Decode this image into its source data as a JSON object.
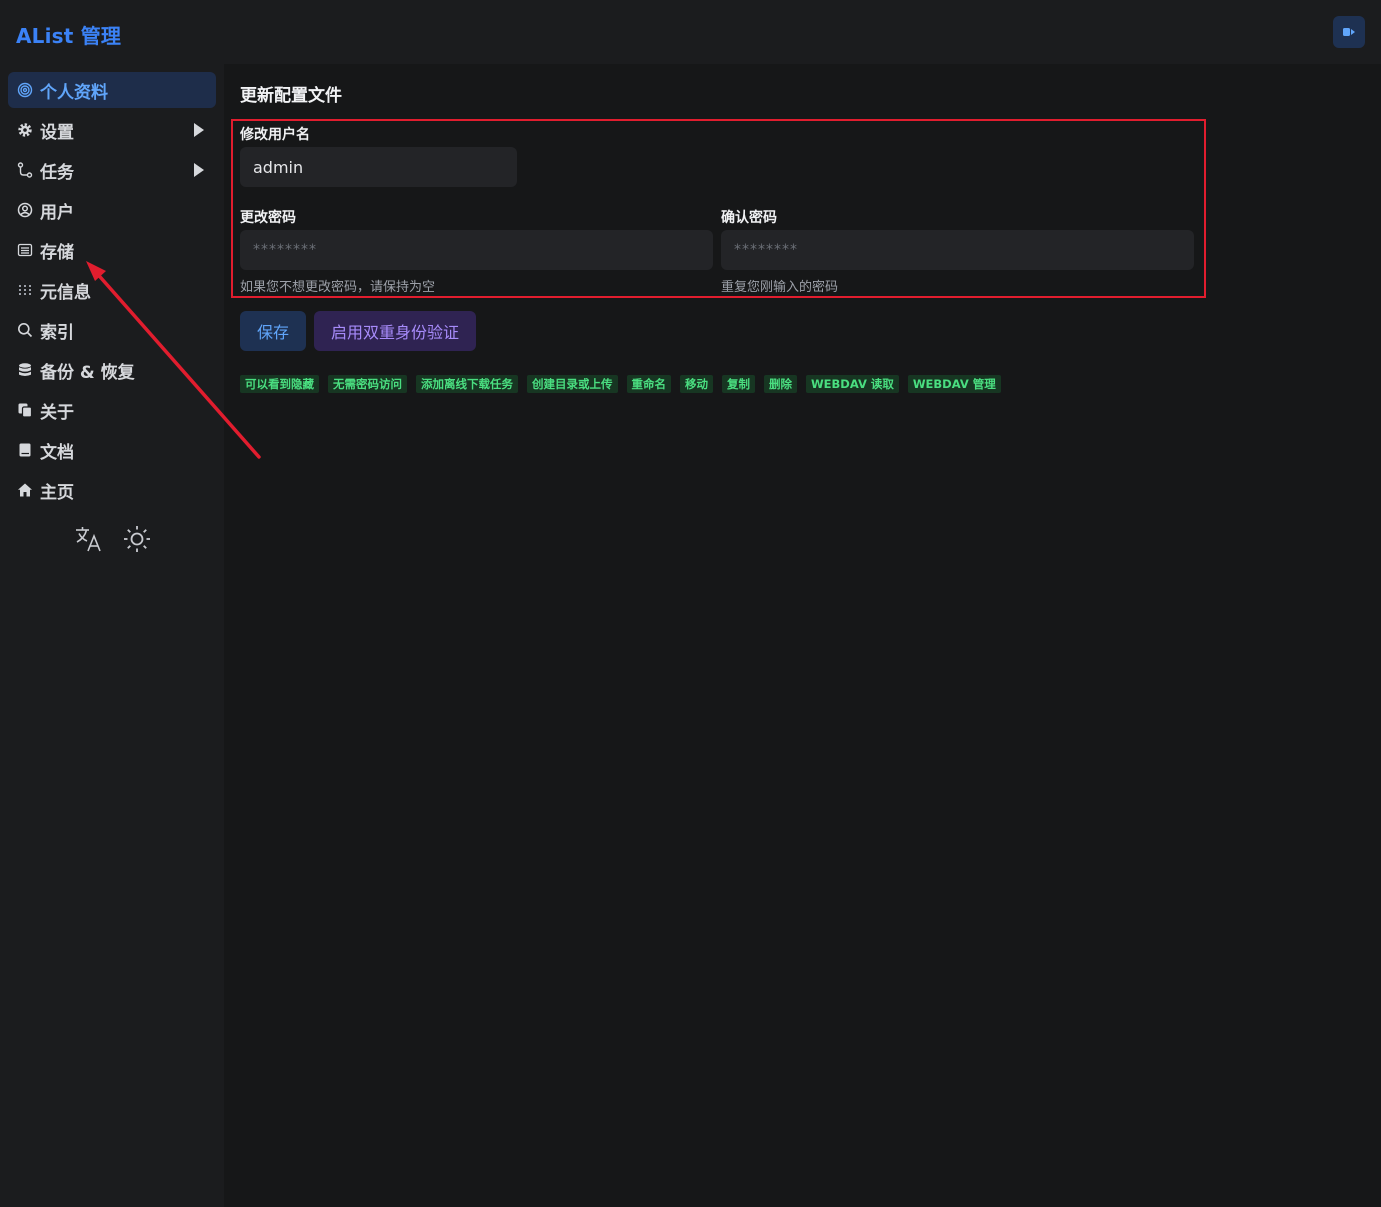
{
  "header": {
    "brand": "AList 管理",
    "logout_icon": "logout-icon"
  },
  "sidebar": {
    "items": [
      {
        "label": "个人资料",
        "icon": "fingerprint-icon",
        "active": true
      },
      {
        "label": "设置",
        "icon": "gear-icon",
        "expandable": true
      },
      {
        "label": "任务",
        "icon": "route-icon",
        "expandable": true
      },
      {
        "label": "用户",
        "icon": "user-circle-icon"
      },
      {
        "label": "存储",
        "icon": "storage-icon"
      },
      {
        "label": "元信息",
        "icon": "meta-icon"
      },
      {
        "label": "索引",
        "icon": "search-icon"
      },
      {
        "label": "备份 & 恢复",
        "icon": "database-icon"
      },
      {
        "label": "关于",
        "icon": "copy-icon"
      },
      {
        "label": "文档",
        "icon": "book-icon"
      },
      {
        "label": "主页",
        "icon": "home-icon"
      }
    ],
    "tools": {
      "language_icon": "translate-icon",
      "theme_icon": "sun-icon"
    }
  },
  "main": {
    "title": "更新配置文件",
    "username": {
      "label": "修改用户名",
      "value": "admin"
    },
    "password": {
      "label": "更改密码",
      "placeholder": "********",
      "help": "如果您不想更改密码，请保持为空"
    },
    "confirm": {
      "label": "确认密码",
      "placeholder": "********",
      "help": "重复您刚输入的密码"
    },
    "buttons": {
      "save": "保存",
      "twofa": "启用双重身份验证"
    },
    "permissions": [
      "可以看到隐藏",
      "无需密码访问",
      "添加离线下载任务",
      "创建目录或上传",
      "重命名",
      "移动",
      "复制",
      "删除",
      "WEBDAV 读取",
      "WEBDAV 管理"
    ]
  },
  "colors": {
    "accent": "#60a5fa",
    "annotation": "#e11d2e",
    "tag_text": "#4ade80"
  }
}
